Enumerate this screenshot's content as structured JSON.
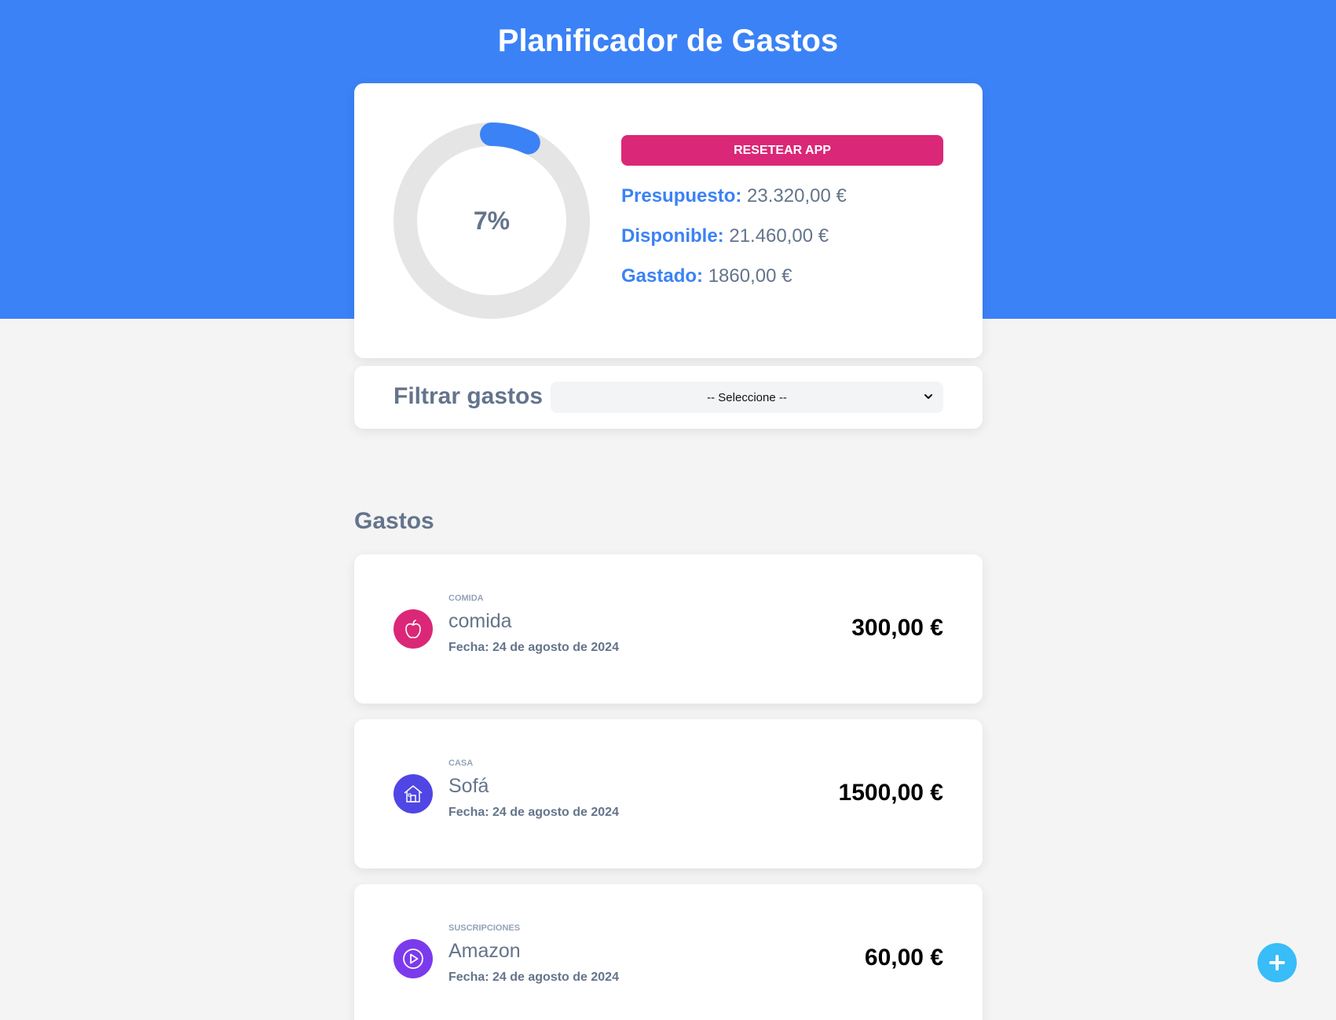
{
  "header": {
    "title": "Planificador de Gastos"
  },
  "budget": {
    "percent_label": "7%",
    "percent_spent": 7,
    "reset_label": "Resetear app",
    "presupuesto_label": "Presupuesto:",
    "presupuesto_value": "23.320,00 €",
    "disponible_label": "Disponible:",
    "disponible_value": "21.460,00 €",
    "gastado_label": "Gastado:",
    "gastado_value": "1860,00 €"
  },
  "filter": {
    "label": "Filtrar gastos",
    "selected": "-- Seleccione --"
  },
  "expenses_section": {
    "title": "Gastos"
  },
  "expenses": [
    {
      "category": "Comida",
      "name": "comida",
      "date": "Fecha: 24 de agosto de 2024",
      "amount": "300,00 €",
      "icon": "apple-icon",
      "color": "#db2777"
    },
    {
      "category": "Casa",
      "name": "Sofá",
      "date": "Fecha: 24 de agosto de 2024",
      "amount": "1500,00 €",
      "icon": "house-icon",
      "color": "#4f46e5"
    },
    {
      "category": "Suscripciones",
      "name": "Amazon",
      "date": "Fecha: 24 de agosto de 2024",
      "amount": "60,00 €",
      "icon": "play-icon",
      "color": "#7c3aed"
    }
  ],
  "colors": {
    "primary": "#3b82f6",
    "reset": "#db2777",
    "fab": "#38bdf8",
    "track": "#e5e5e5"
  },
  "fab": {
    "icon": "plus-icon"
  }
}
